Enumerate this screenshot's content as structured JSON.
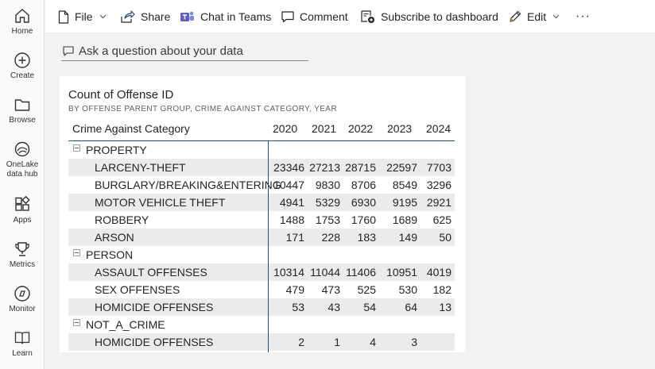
{
  "nav": {
    "items": [
      {
        "label": "Home",
        "icon": "home-icon"
      },
      {
        "label": "Create",
        "icon": "create-icon"
      },
      {
        "label": "Browse",
        "icon": "browse-icon"
      },
      {
        "label": "OneLake data hub",
        "label_line1": "OneLake",
        "label_line2": "data hub",
        "icon": "onelake-icon"
      },
      {
        "label": "Apps",
        "icon": "apps-icon"
      },
      {
        "label": "Metrics",
        "icon": "metrics-icon"
      },
      {
        "label": "Monitor",
        "icon": "monitor-icon"
      },
      {
        "label": "Learn",
        "icon": "learn-icon"
      }
    ]
  },
  "toolbar": {
    "file": "File",
    "share": "Share",
    "chat": "Chat in Teams",
    "comment": "Comment",
    "subscribe": "Subscribe to dashboard",
    "edit": "Edit",
    "more": "···",
    "teams_color": "#5b5fc7"
  },
  "qna": {
    "placeholder": "Ask a question about your data"
  },
  "visual": {
    "title": "Count of Offense ID",
    "subtitle": "BY OFFENSE PARENT GROUP, CRIME AGAINST CATEGORY, YEAR",
    "row_header": "Crime Against Category",
    "years": [
      "2020",
      "2021",
      "2022",
      "2023",
      "2024"
    ],
    "groups": [
      {
        "name": "PROPERTY",
        "rows": [
          {
            "label": "LARCENY-THEFT",
            "values": [
              "23346",
              "27213",
              "28715",
              "22597",
              "7703"
            ]
          },
          {
            "label": "BURGLARY/BREAKING&ENTERING",
            "values": [
              "10447",
              "9830",
              "8706",
              "8549",
              "3296"
            ]
          },
          {
            "label": "MOTOR VEHICLE THEFT",
            "values": [
              "4941",
              "5329",
              "6930",
              "9195",
              "2921"
            ]
          },
          {
            "label": "ROBBERY",
            "values": [
              "1488",
              "1753",
              "1760",
              "1689",
              "625"
            ]
          },
          {
            "label": "ARSON",
            "values": [
              "171",
              "228",
              "183",
              "149",
              "50"
            ]
          }
        ]
      },
      {
        "name": "PERSON",
        "rows": [
          {
            "label": "ASSAULT OFFENSES",
            "values": [
              "10314",
              "11044",
              "11406",
              "10951",
              "4019"
            ]
          },
          {
            "label": "SEX OFFENSES",
            "values": [
              "479",
              "473",
              "525",
              "530",
              "182"
            ]
          },
          {
            "label": "HOMICIDE OFFENSES",
            "values": [
              "53",
              "43",
              "54",
              "64",
              "13"
            ]
          }
        ]
      },
      {
        "name": "NOT_A_CRIME",
        "rows": [
          {
            "label": "HOMICIDE OFFENSES",
            "values": [
              "2",
              "1",
              "4",
              "3",
              ""
            ]
          }
        ]
      }
    ],
    "header_line_color": "#1f4e79",
    "band_color": "#ebebeb"
  }
}
